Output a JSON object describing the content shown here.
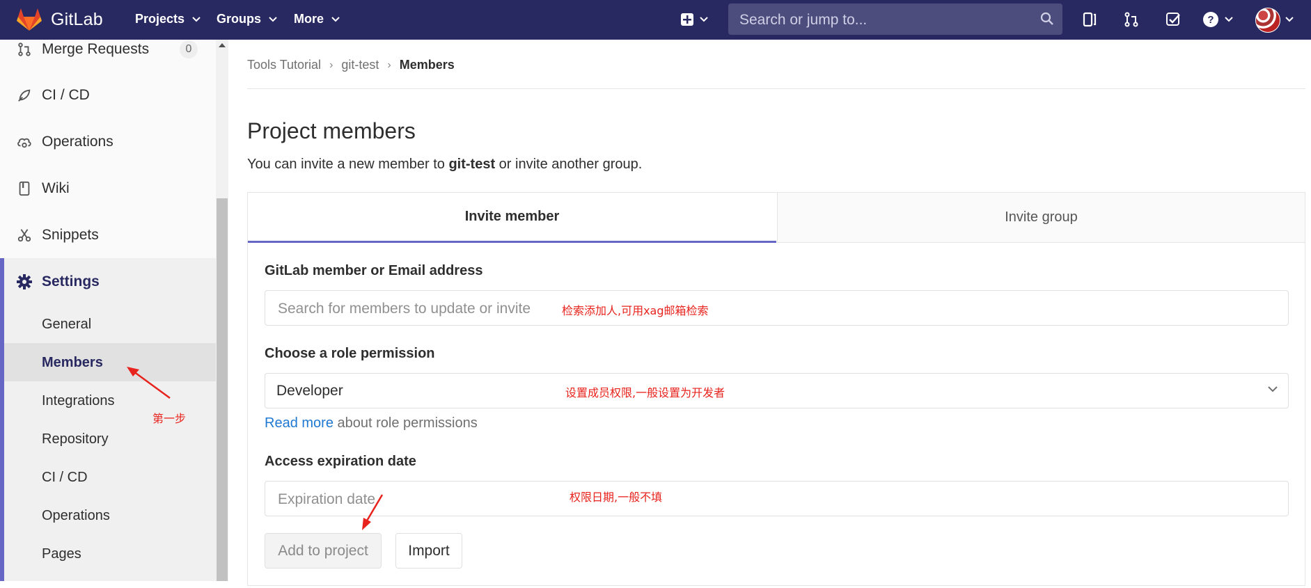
{
  "navbar": {
    "brand": "GitLab",
    "projects_label": "Projects",
    "groups_label": "Groups",
    "more_label": "More",
    "search_placeholder": "Search or jump to..."
  },
  "sidebar": {
    "items": [
      {
        "label": "Merge Requests",
        "count": "0",
        "icon": "merge-request-icon"
      },
      {
        "label": "CI / CD",
        "icon": "rocket-icon"
      },
      {
        "label": "Operations",
        "icon": "cloud-gear-icon"
      },
      {
        "label": "Wiki",
        "icon": "book-icon"
      },
      {
        "label": "Snippets",
        "icon": "scissors-icon"
      },
      {
        "label": "Settings",
        "icon": "gear-icon"
      }
    ],
    "settings_subitems": [
      "General",
      "Members",
      "Integrations",
      "Repository",
      "CI / CD",
      "Operations",
      "Pages"
    ]
  },
  "breadcrumb": [
    "Tools Tutorial",
    "git-test",
    "Members"
  ],
  "page": {
    "title": "Project members",
    "subtitle_before": "You can invite a new member to ",
    "subtitle_project": "git-test",
    "subtitle_after": " or invite another group."
  },
  "tabs": {
    "invite_member": "Invite member",
    "invite_group": "Invite group"
  },
  "form": {
    "member_label": "GitLab member or Email address",
    "member_placeholder": "Search for members to update or invite",
    "role_label": "Choose a role permission",
    "role_value": "Developer",
    "help_link": "Read more",
    "help_text": " about role permissions",
    "expiry_label": "Access expiration date",
    "expiry_placeholder": "Expiration date",
    "add_button": "Add to project",
    "import_button": "Import"
  },
  "annotations": {
    "step1": "第一步",
    "member_note": "检索添加人,可用xag邮箱检索",
    "role_note": "设置成员权限,一般设置为开发者",
    "expiry_note": "权限日期,一般不填"
  },
  "colors": {
    "navbar": "#292961",
    "accent": "#6666c4",
    "link": "#1f78d1",
    "annotation": "#e8221c"
  }
}
